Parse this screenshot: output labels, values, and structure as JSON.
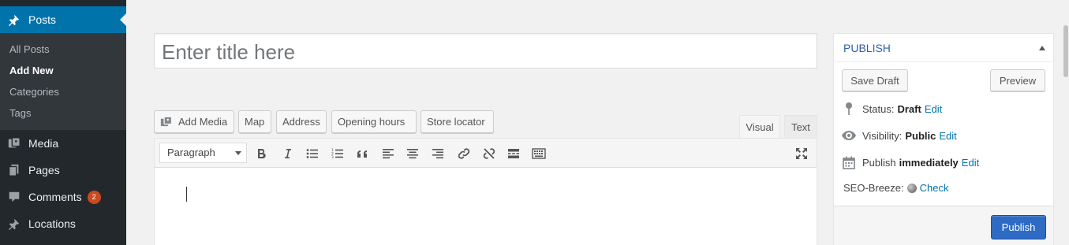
{
  "sidebar": {
    "posts_label": "Posts",
    "submenu": [
      "All Posts",
      "Add New",
      "Categories",
      "Tags"
    ],
    "media_label": "Media",
    "pages_label": "Pages",
    "comments_label": "Comments",
    "comments_count": "2",
    "locations_label": "Locations"
  },
  "title": {
    "placeholder": "Enter title here",
    "value": ""
  },
  "media_buttons": {
    "add_media": "Add Media",
    "map": "Map",
    "address": "Address",
    "opening_hours": "Opening hours",
    "store_locator": "Store locator"
  },
  "editor_tabs": {
    "visual": "Visual",
    "text": "Text"
  },
  "toolbar": {
    "format": "Paragraph",
    "icons": [
      "bold-icon",
      "italic-icon",
      "bullet-list-icon",
      "numbered-list-icon",
      "blockquote-icon",
      "align-left-icon",
      "align-center-icon",
      "align-right-icon",
      "link-icon",
      "unlink-icon",
      "read-more-icon",
      "toolbar-toggle-icon",
      "fullscreen-icon"
    ]
  },
  "publish": {
    "title": "PUBLISH",
    "save_draft": "Save Draft",
    "preview": "Preview",
    "status_label": "Status:",
    "status_value": "Draft",
    "visibility_label": "Visibility:",
    "visibility_value": "Public",
    "publish_label": "Publish",
    "publish_value": "immediately",
    "edit": "Edit",
    "seo_label": "SEO-Breeze:",
    "seo_check": "Check",
    "publish_button": "Publish"
  },
  "colors": {
    "sidebar_bg": "#23282d",
    "active_menu": "#0073aa",
    "link": "#0073aa",
    "primary_button": "#2e6bc4",
    "badge": "#ca4a1f"
  }
}
